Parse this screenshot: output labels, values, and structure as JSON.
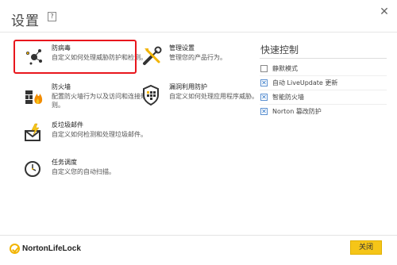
{
  "window": {
    "title": "设置",
    "help_label": "?",
    "close_glyph": "✕"
  },
  "items": [
    {
      "name": "防病毒",
      "desc": "自定义如何处理威胁防护和检测。",
      "icon": "antivirus-icon"
    },
    {
      "name": "防火墙",
      "desc": "配置防火墙行为以及访问和连接规则。",
      "icon": "firewall-icon"
    },
    {
      "name": "反垃圾邮件",
      "desc": "自定义如何检测和处理垃圾邮件。",
      "icon": "antispam-icon"
    },
    {
      "name": "任务调度",
      "desc": "自定义您的自动扫描。",
      "icon": "task-schedule-icon"
    },
    {
      "name": "管理设置",
      "desc": "管理您的产品行为。",
      "icon": "admin-settings-icon"
    },
    {
      "name": "漏洞利用防护",
      "desc": "自定义如何处理应用程序威胁。",
      "icon": "exploit-protection-icon"
    }
  ],
  "quick_controls": {
    "title": "快速控制",
    "items": [
      {
        "label": "静默模式",
        "checked": false
      },
      {
        "label": "自动 LiveUpdate 更新",
        "checked": true
      },
      {
        "label": "智能防火墙",
        "checked": true
      },
      {
        "label": "Norton 篡改防护",
        "checked": true
      }
    ]
  },
  "footer": {
    "brand": "NortonLifeLock",
    "close_button": "关闭"
  },
  "colors": {
    "highlight": "#e8161d",
    "accent_yellow": "#f5c518",
    "checkbox_blue": "#2a73c6"
  }
}
